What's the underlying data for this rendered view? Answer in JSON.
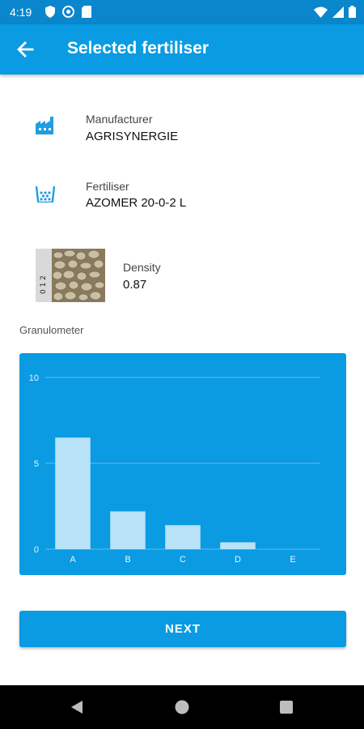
{
  "status": {
    "time": "4:19",
    "icons_left": [
      "shield-icon",
      "at-icon",
      "sd-card-icon"
    ],
    "icons_right": [
      "wifi-icon",
      "signal-icon",
      "battery-icon"
    ]
  },
  "app_bar": {
    "title": "Selected fertiliser",
    "back_icon": "arrow-left-icon"
  },
  "manufacturer": {
    "label": "Manufacturer",
    "value": "AGRISYNERGIE",
    "icon": "factory-icon"
  },
  "fertiliser": {
    "label": "Fertiliser",
    "value": "AZOMER 20-0-2  L",
    "icon": "fertiliser-bucket-icon"
  },
  "density": {
    "label": "Density",
    "value": "0.87",
    "image": "granules-photo",
    "ruler_text": "0 1 2"
  },
  "granulometer": {
    "label": "Granulometer"
  },
  "chart_data": {
    "type": "bar",
    "categories": [
      "A",
      "B",
      "C",
      "D",
      "E"
    ],
    "values": [
      6.5,
      2.2,
      1.4,
      0.4,
      0.0
    ],
    "ylim": [
      0,
      10
    ],
    "yticks": [
      0,
      5,
      10
    ],
    "grid": true,
    "colors": {
      "background": "#0a9be2",
      "bar": "#b8e2f8",
      "text": "#e8f6ff"
    }
  },
  "next_button": {
    "label": "NEXT"
  },
  "colors": {
    "primary": "#0a9be2",
    "status_bar": "#0a86cc",
    "icon": "#1f9ee0"
  }
}
